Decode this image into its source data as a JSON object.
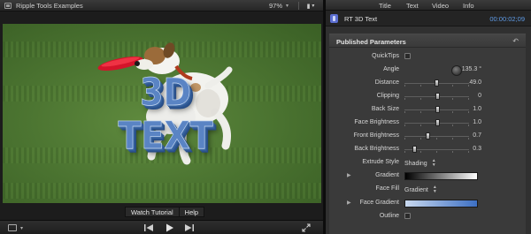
{
  "viewer": {
    "title": "Ripple Tools Examples",
    "zoom": "97%",
    "zoom_chevron": "⌄",
    "display_icon": "display-options-icon",
    "overlay_text": "3D TEXT",
    "buttons": {
      "watch_tutorial": "Watch Tutorial",
      "help": "Help"
    },
    "bottom": {
      "view_options_icon": "view-options-icon",
      "transport_icons": [
        "previous-icon",
        "play-icon",
        "next-icon"
      ],
      "fullscreen_icon": "fullscreen-icon"
    }
  },
  "inspector": {
    "tabs": [
      "Title",
      "Text",
      "Video",
      "Info"
    ],
    "header": {
      "plugin_icon": "plugin-icon",
      "title": "RT 3D Text",
      "timecode": "00:00:02;09"
    },
    "section": {
      "label": "Published Parameters",
      "reset_icon": "reset-icon"
    },
    "params": [
      {
        "label": "QuickTips",
        "control": "checkbox",
        "checked": false
      },
      {
        "label": "Angle",
        "control": "dial",
        "value": "135.3 °"
      },
      {
        "label": "Distance",
        "control": "slider",
        "value": "49.0",
        "level": 0.49
      },
      {
        "label": "Clipping",
        "control": "slider",
        "value": "0",
        "level": 0.5
      },
      {
        "label": "Back Size",
        "control": "slider",
        "value": "1.0",
        "level": 0.5
      },
      {
        "label": "Face Brightness",
        "control": "slider",
        "value": "1.0",
        "level": 0.5
      },
      {
        "label": "Front Brightness",
        "control": "slider",
        "value": "0.7",
        "level": 0.35
      },
      {
        "label": "Back Brightness",
        "control": "slider",
        "value": "0.3",
        "level": 0.15
      },
      {
        "label": "Extrude Style",
        "control": "popup",
        "value": "Shading"
      },
      {
        "label": "Gradient",
        "control": "gradient",
        "disclosure": true,
        "colors": [
          "#000000",
          "#ffffff"
        ]
      },
      {
        "label": "Face Fill",
        "control": "popup",
        "value": "Gradient"
      },
      {
        "label": "Face Gradient",
        "control": "gradient",
        "disclosure": true,
        "colors": [
          "#c9d9ef",
          "#3d70c4"
        ]
      },
      {
        "label": "Outline",
        "control": "checkbox",
        "checked": false
      }
    ]
  },
  "colors": {
    "accent_blue": "#5f9be6",
    "text3d": "#5a84c4",
    "grass": "#4d7632"
  }
}
